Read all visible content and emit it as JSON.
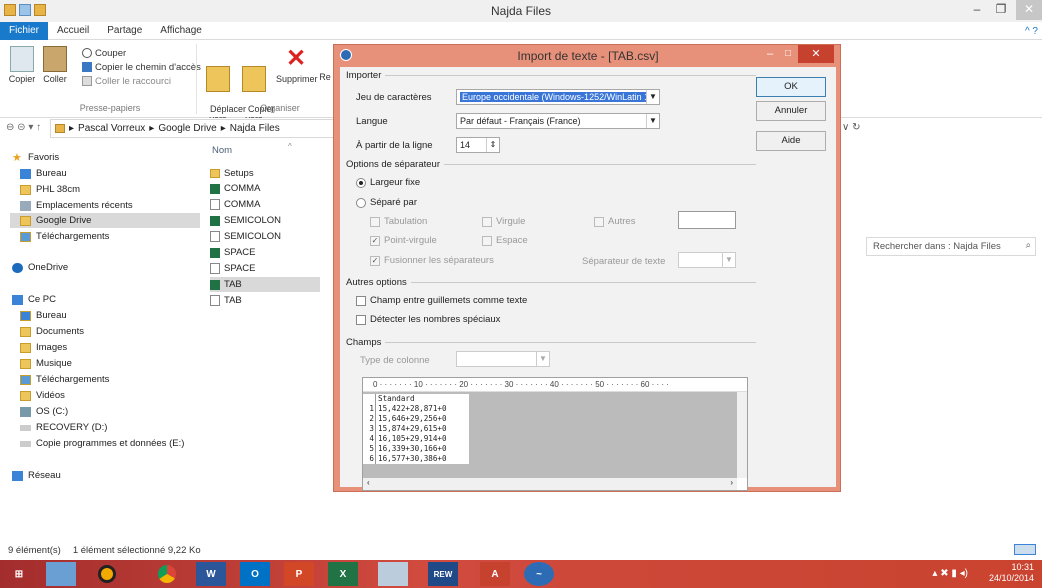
{
  "window": {
    "title": "Najda Files",
    "min": "–",
    "max": "❐",
    "close": "✕"
  },
  "ribbon_tabs": [
    "Fichier",
    "Accueil",
    "Partage",
    "Affichage"
  ],
  "ribbon": {
    "copy": "Copier",
    "paste": "Coller",
    "cut": "Couper",
    "copy_path": "Copier le chemin d'accès",
    "paste_shortcut": "Coller le raccourci",
    "clipboard_group": "Presse-papiers",
    "move_to": "Déplacer\nvers",
    "copy_to": "Copier\nvers",
    "delete": "Supprimer",
    "rename": "Re",
    "organize_group": "Organiser"
  },
  "address": {
    "crumbs": [
      "Pascal Vorreux",
      "Google Drive",
      "Najda Files"
    ],
    "search_placeholder": "Rechercher dans : Najda Files"
  },
  "nav": {
    "favorites": "Favoris",
    "fav_items": [
      "Bureau",
      "PHL 38cm",
      "Emplacements récents",
      "Google Drive",
      "Téléchargements"
    ],
    "onedrive": "OneDrive",
    "pc": "Ce PC",
    "pc_items": [
      "Bureau",
      "Documents",
      "Images",
      "Musique",
      "Téléchargements",
      "Vidéos",
      "OS (C:)",
      "RECOVERY (D:)",
      "Copie programmes et données (E:)"
    ],
    "network": "Réseau"
  },
  "files": {
    "header": "Nom",
    "items": [
      {
        "name": "Setups",
        "type": "folder"
      },
      {
        "name": "COMMA",
        "type": "excel"
      },
      {
        "name": "COMMA",
        "type": "text"
      },
      {
        "name": "SEMICOLON",
        "type": "excel"
      },
      {
        "name": "SEMICOLON",
        "type": "text"
      },
      {
        "name": "SPACE",
        "type": "excel"
      },
      {
        "name": "SPACE",
        "type": "text"
      },
      {
        "name": "TAB",
        "type": "excel"
      },
      {
        "name": "TAB",
        "type": "text"
      }
    ]
  },
  "status": {
    "count": "9 élément(s)",
    "selection": "1 élément sélectionné 9,22 Ko"
  },
  "dialog": {
    "title": "Import de texte - [TAB.csv]",
    "importer": "Importer",
    "charset_label": "Jeu de caractères",
    "charset_value": "Europe occidentale (Windows-1252/WinLatin 1)",
    "language_label": "Langue",
    "language_value": "Par défaut - Français (France)",
    "from_line_label": "À partir de la ligne",
    "from_line_value": "14",
    "sep_options": "Options de séparateur",
    "fixed_width": "Largeur fixe",
    "separated_by": "Séparé par",
    "tab": "Tabulation",
    "comma": "Virgule",
    "others": "Autres",
    "semicolon": "Point-virgule",
    "space": "Espace",
    "merge": "Fusionner les séparateurs",
    "text_sep": "Séparateur de texte",
    "other_options": "Autres options",
    "quoted_as_text": "Champ entre guillemets comme texte",
    "detect_special": "Détecter les nombres spéciaux",
    "fields": "Champs",
    "column_type": "Type de colonne",
    "ok": "OK",
    "cancel": "Annuler",
    "help": "Aide",
    "ruler": "0 · · · · · · · 10 · · · · · · · 20 · · · · · · · 30 · · · · · · · 40 · · · · · · · 50 · · · · · · · 60 · · · ·",
    "column_header": "Standard",
    "rows": [
      {
        "n": "1",
        "v": "15,422+28,871+0"
      },
      {
        "n": "2",
        "v": "15,646+29,256+0"
      },
      {
        "n": "3",
        "v": "15,874+29,615+0"
      },
      {
        "n": "4",
        "v": "16,105+29,914+0"
      },
      {
        "n": "5",
        "v": "16,339+30,166+0"
      },
      {
        "n": "6",
        "v": "16,577+30,386+0"
      }
    ]
  },
  "taskbar": {
    "time": "10:31",
    "date": "24/10/2014"
  }
}
